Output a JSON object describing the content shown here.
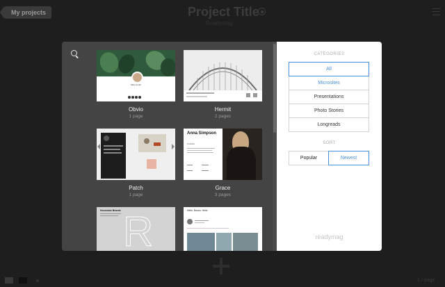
{
  "header": {
    "back_label": "My projects",
    "title": "Project Title",
    "subtitle": "Readymag"
  },
  "gallery": {
    "templates": [
      {
        "name": "Obvio",
        "pages": "1 page"
      },
      {
        "name": "Hermit",
        "pages": "2 pages"
      },
      {
        "name": "Patch",
        "pages": "1 page"
      },
      {
        "name": "Grace",
        "pages": "3 pages"
      },
      {
        "name": "",
        "pages": ""
      },
      {
        "name": "",
        "pages": ""
      }
    ],
    "thumb_text": {
      "obvio_name": "Mike Smith",
      "grace_name": "Anna Simpson",
      "grace_sub": "Portfolio",
      "r_title": "Hounslow Brands",
      "r_letter": "R",
      "six_title": "Hello, Bosco, Hello"
    }
  },
  "sidebar": {
    "categories_heading": "CATEGORIES",
    "categories": [
      "All",
      "Microsites",
      "Presentations",
      "Photo Stories",
      "Longreads"
    ],
    "sort_heading": "SORT",
    "sort_options": [
      "Popular",
      "Newest"
    ],
    "brand": "readymag"
  },
  "footer": {
    "corner_text": "1 / page"
  },
  "colors": {
    "accent": "#4a90d9",
    "modal_dark": "#444444",
    "page_bg": "#1e1e1e"
  }
}
